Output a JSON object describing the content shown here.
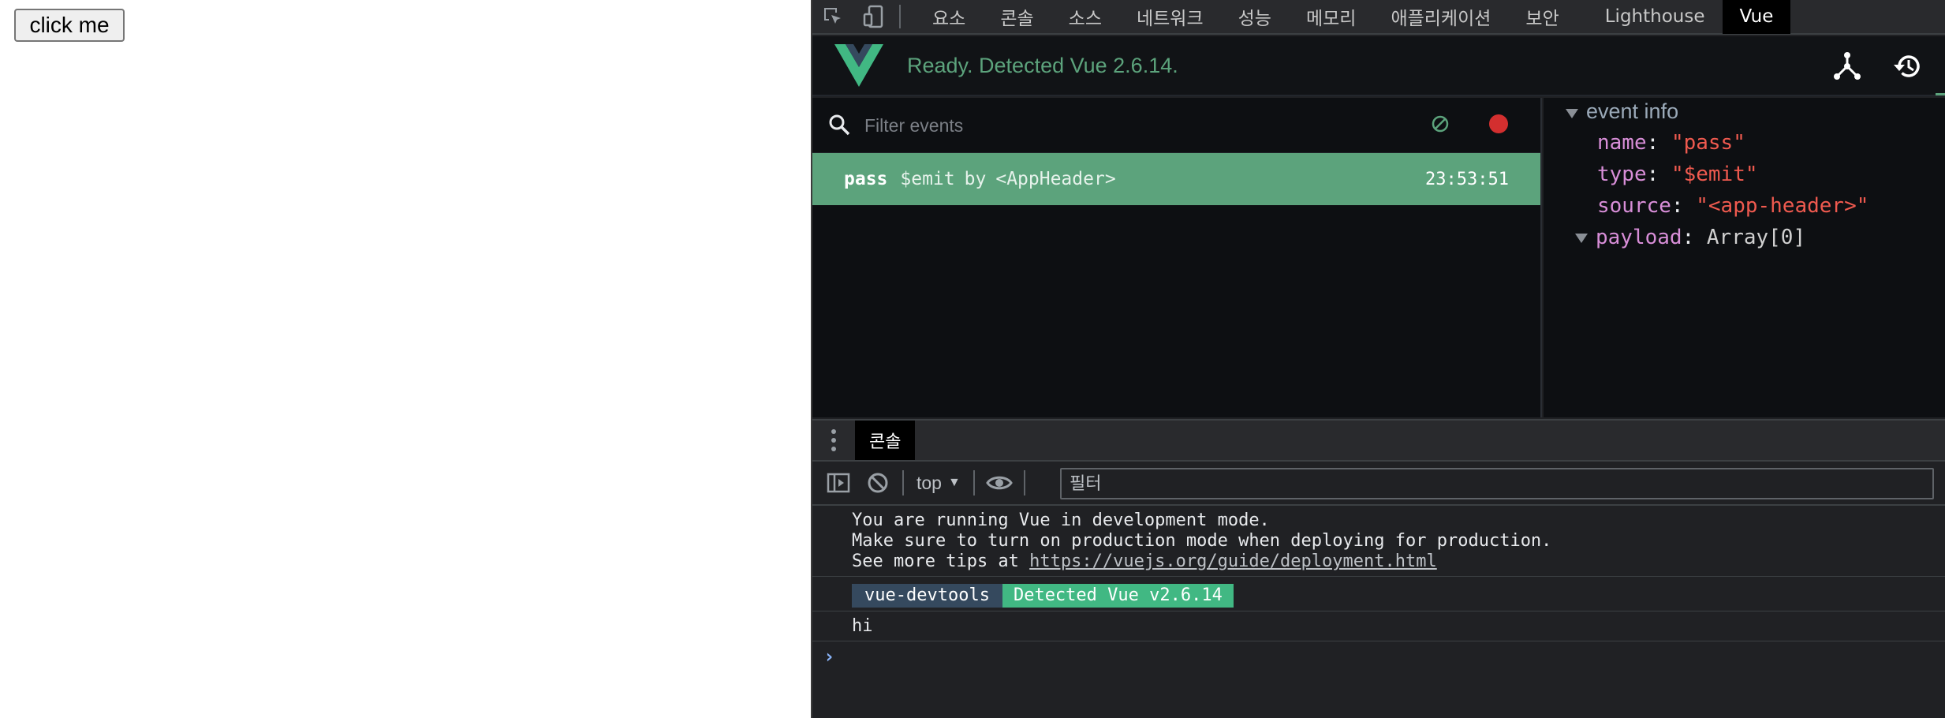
{
  "page": {
    "button_label": "click me"
  },
  "devtools": {
    "tabs": [
      "요소",
      "콘솔",
      "소스",
      "네트워크",
      "성능",
      "메모리",
      "애플리케이션",
      "보안",
      "Lighthouse",
      "Vue"
    ],
    "active_tab": "Vue",
    "vue": {
      "status": "Ready. Detected Vue 2.6.14.",
      "accent": "#5ca37c",
      "events_filter_placeholder": "Filter events",
      "event": {
        "name": "pass",
        "type": "$emit",
        "by": "by",
        "component": "<AppHeader>",
        "time": "23:53:51"
      },
      "info": {
        "title": "event info",
        "name_key": "name",
        "name_val": "\"pass\"",
        "type_key": "type",
        "type_val": "\"$emit\"",
        "source_key": "source",
        "source_val": "\"<app-header>\"",
        "payload_key": "payload",
        "payload_val": "Array[0]"
      }
    },
    "drawer": {
      "tab": "콘솔",
      "context": "top",
      "filter_placeholder": "필터",
      "log1_line1": "You are running Vue in development mode.",
      "log1_line2": "Make sure to turn on production mode when deploying for production.",
      "log1_line3_prefix": "See more tips at ",
      "log1_link": "https://vuejs.org/guide/deployment.html",
      "badge1": "vue-devtools",
      "badge2": "Detected Vue v2.6.14",
      "log3": "hi",
      "prompt": "›"
    }
  }
}
